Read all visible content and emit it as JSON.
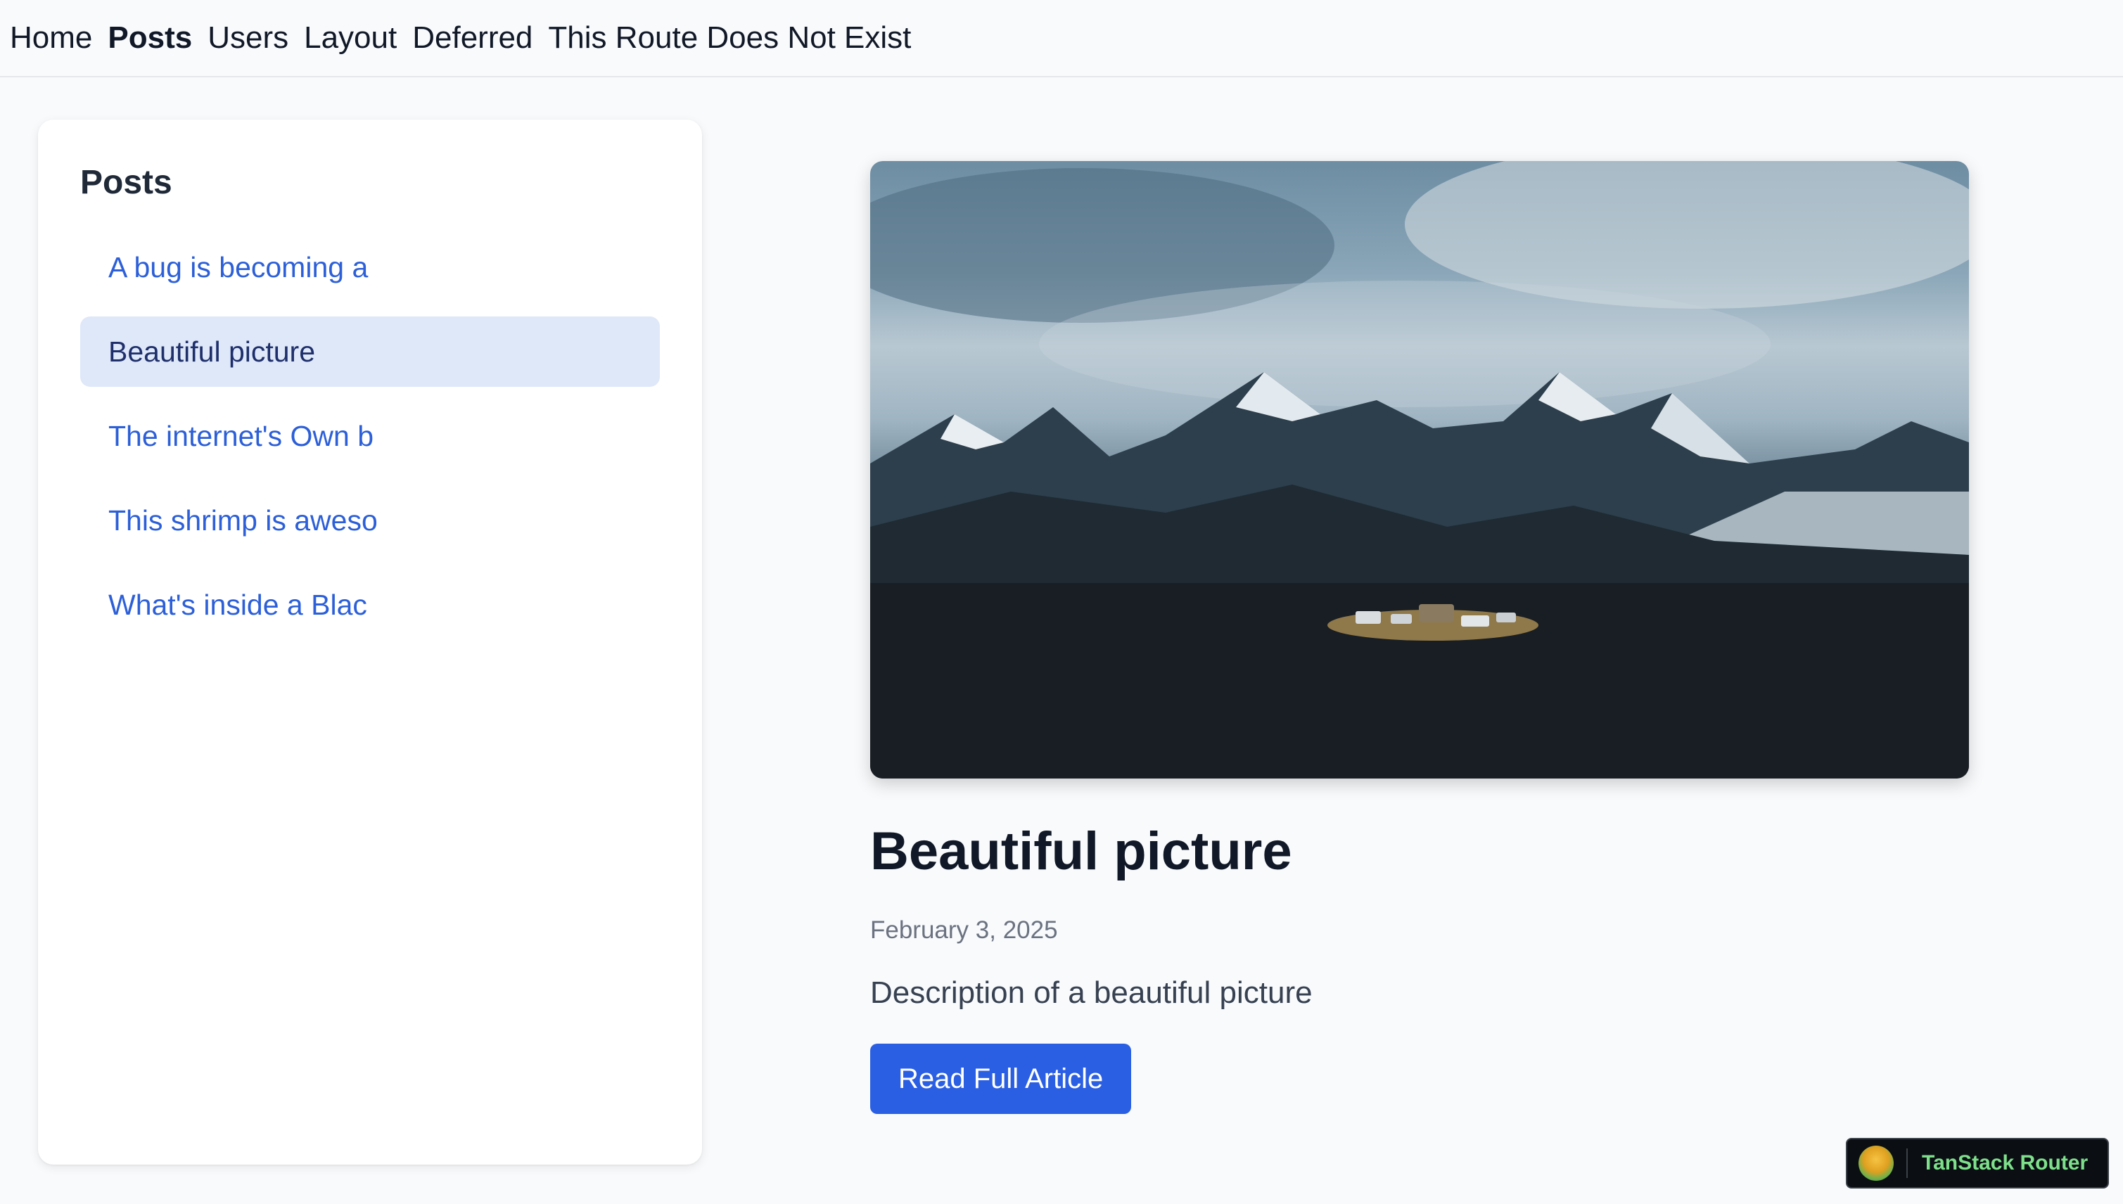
{
  "nav": {
    "items": [
      {
        "label": "Home",
        "active": false
      },
      {
        "label": "Posts",
        "active": true
      },
      {
        "label": "Users",
        "active": false
      },
      {
        "label": "Layout",
        "active": false
      },
      {
        "label": "Deferred",
        "active": false
      },
      {
        "label": "This Route Does Not Exist",
        "active": false
      }
    ]
  },
  "sidebar": {
    "heading": "Posts",
    "items": [
      {
        "label": "A bug is becoming a",
        "active": false
      },
      {
        "label": "Beautiful picture",
        "active": true
      },
      {
        "label": "The internet's Own b",
        "active": false
      },
      {
        "label": "This shrimp is aweso",
        "active": false
      },
      {
        "label": "What's inside a Blac",
        "active": false
      }
    ]
  },
  "post": {
    "image_icon": "mountain-landscape-image",
    "title": "Beautiful picture",
    "date": "February 3, 2025",
    "description": "Description of a beautiful picture",
    "button_label": "Read Full Article"
  },
  "devtools": {
    "label": "TanStack Router",
    "icon": "tanstack-logo-icon"
  },
  "colors": {
    "link": "#2c5fd8",
    "active_bg": "#dfe8f8",
    "button": "#2b5fe3",
    "devtools_text": "#7ee08a"
  }
}
